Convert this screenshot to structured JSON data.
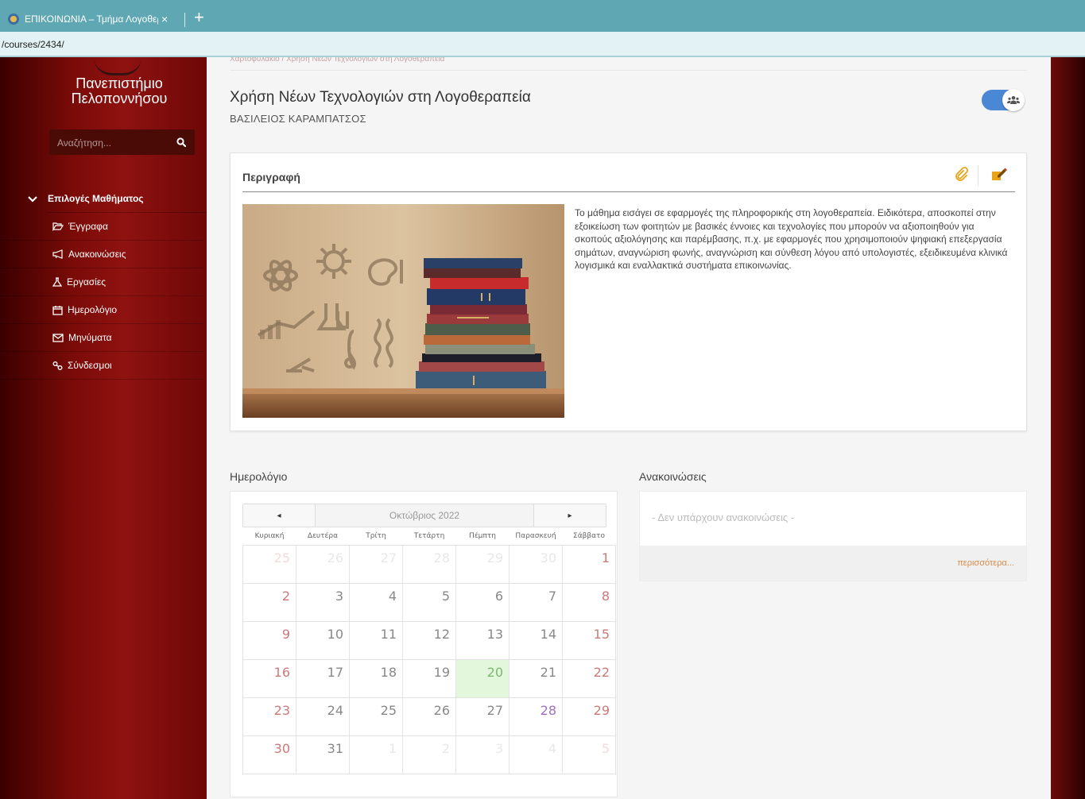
{
  "browser": {
    "tab_title": "ΕΠΙΚΟΙΝΩΝΙΑ – Τμήμα Λογοθερ",
    "tab_close": "×",
    "new_tab": "+",
    "url": "/courses/2434/"
  },
  "sidebar": {
    "university_line1": "Πανεπιστήμιο",
    "university_line2": "Πελοποννήσου",
    "search_placeholder": "Αναζήτηση...",
    "menu_header": "Επιλογές Μαθήματος",
    "items": [
      {
        "label": "Έγγραφα",
        "icon": "folder-open-icon"
      },
      {
        "label": "Ανακοινώσεις",
        "icon": "bullhorn-icon"
      },
      {
        "label": "Εργασίες",
        "icon": "flask-icon"
      },
      {
        "label": "Ημερολόγιο",
        "icon": "calendar-icon"
      },
      {
        "label": "Μηνύματα",
        "icon": "envelope-icon"
      },
      {
        "label": "Σύνδεσμοι",
        "icon": "link-icon"
      }
    ]
  },
  "course": {
    "breadcrumb": "Χαρτοφυλάκιο / Χρήση Νέων Τεχνολογιών στη Λογοθεραπεία",
    "title": "Χρήση Νέων Τεχνολογιών στη Λογοθεραπεία",
    "instructor": "ΒΑΣΙΛΕΙΟΣ ΚΑΡΑΜΠΑΤΣΟΣ"
  },
  "description": {
    "title": "Περιγραφή",
    "text": "Το μάθημα εισάγει σε εφαρμογές της πληροφορικής στη λογοθεραπεία. Ειδικότερα, αποσκοπεί στην εξοικείωση των φοιτητών με βασικές έννοιες και τεχνολογίες που μπορούν να αξιοποιηθούν για σκοπούς αξιολόγησης και παρέμβασης, π.χ. με εφαρμογές που χρησιμοποιούν ψηφιακή επεξεργασία σημάτων, αναγνώριση φωνής, αναγνώριση και σύνθεση λόγου από υπολογιστές, εξειδικευμένα κλινικά λογισμικά και εναλλακτικά συστήματα επικοινωνίας."
  },
  "calendar": {
    "title": "Ημερολόγιο",
    "month_label": "Οκτώβριος 2022",
    "prev": "◂",
    "next": "▸",
    "weekdays": [
      "Κυριακή",
      "Δευτέρα",
      "Τρίτη",
      "Τετάρτη",
      "Πέμπτη",
      "Παρασκευή",
      "Σάββατο"
    ],
    "weeks": [
      [
        "25",
        "26",
        "27",
        "28",
        "29",
        "30",
        "1"
      ],
      [
        "2",
        "3",
        "4",
        "5",
        "6",
        "7",
        "8"
      ],
      [
        "9",
        "10",
        "11",
        "12",
        "13",
        "14",
        "15"
      ],
      [
        "16",
        "17",
        "18",
        "19",
        "20",
        "21",
        "22"
      ],
      [
        "23",
        "24",
        "25",
        "26",
        "27",
        "28",
        "29"
      ],
      [
        "30",
        "31",
        "1",
        "2",
        "3",
        "4",
        "5"
      ]
    ]
  },
  "announcements": {
    "title": "Ανακοινώσεις",
    "empty": "- Δεν υπάρχουν ανακοινώσεις -",
    "more": "περισσότερα..."
  },
  "colors": {
    "accent": "#4a88d6",
    "link": "#d98b4b",
    "today": "#e3f7dd",
    "sidebar": "#7a0b08"
  }
}
